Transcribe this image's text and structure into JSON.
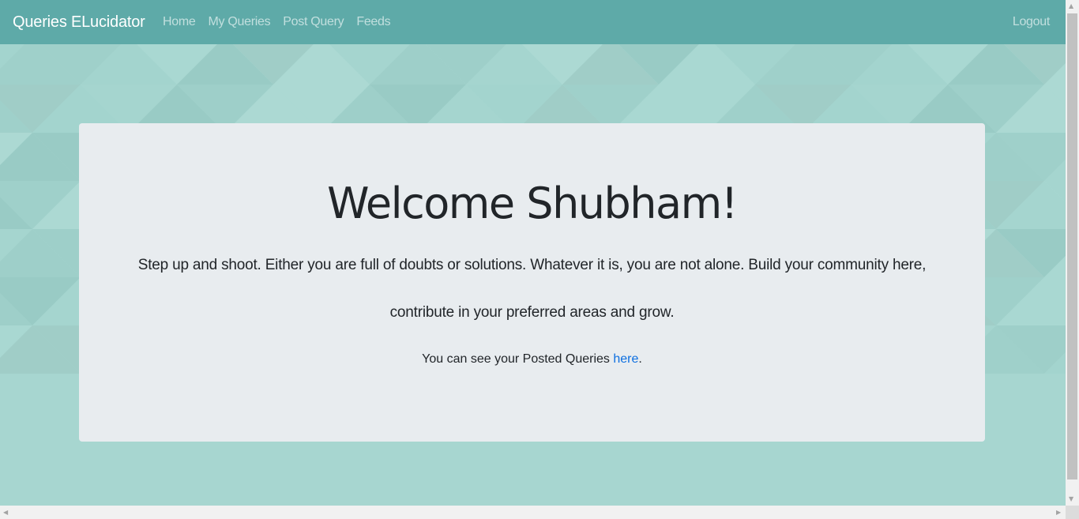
{
  "navbar": {
    "brand": "Queries ELucidator",
    "links": [
      {
        "label": "Home"
      },
      {
        "label": "My Queries"
      },
      {
        "label": "Post Query"
      },
      {
        "label": "Feeds"
      }
    ],
    "logout": "Logout"
  },
  "jumbotron": {
    "title": "Welcome Shubham!",
    "lead": "Step up and shoot. Either you are full of doubts or solutions. Whatever it is, you are not alone. Build your community here, contribute in your preferred areas and grow.",
    "posted_prefix": "You can see your Posted Queries ",
    "posted_link": "here",
    "posted_suffix": "."
  },
  "scrollbars": {
    "up_arrow": "▲",
    "down_arrow": "▼",
    "left_arrow": "◀",
    "right_arrow": "▶"
  },
  "colors": {
    "navbar_bg": "#5eaaa8",
    "page_bg": "#a7d6d0",
    "jumbotron_bg": "#e8ecef",
    "link": "#0d6fe0"
  }
}
